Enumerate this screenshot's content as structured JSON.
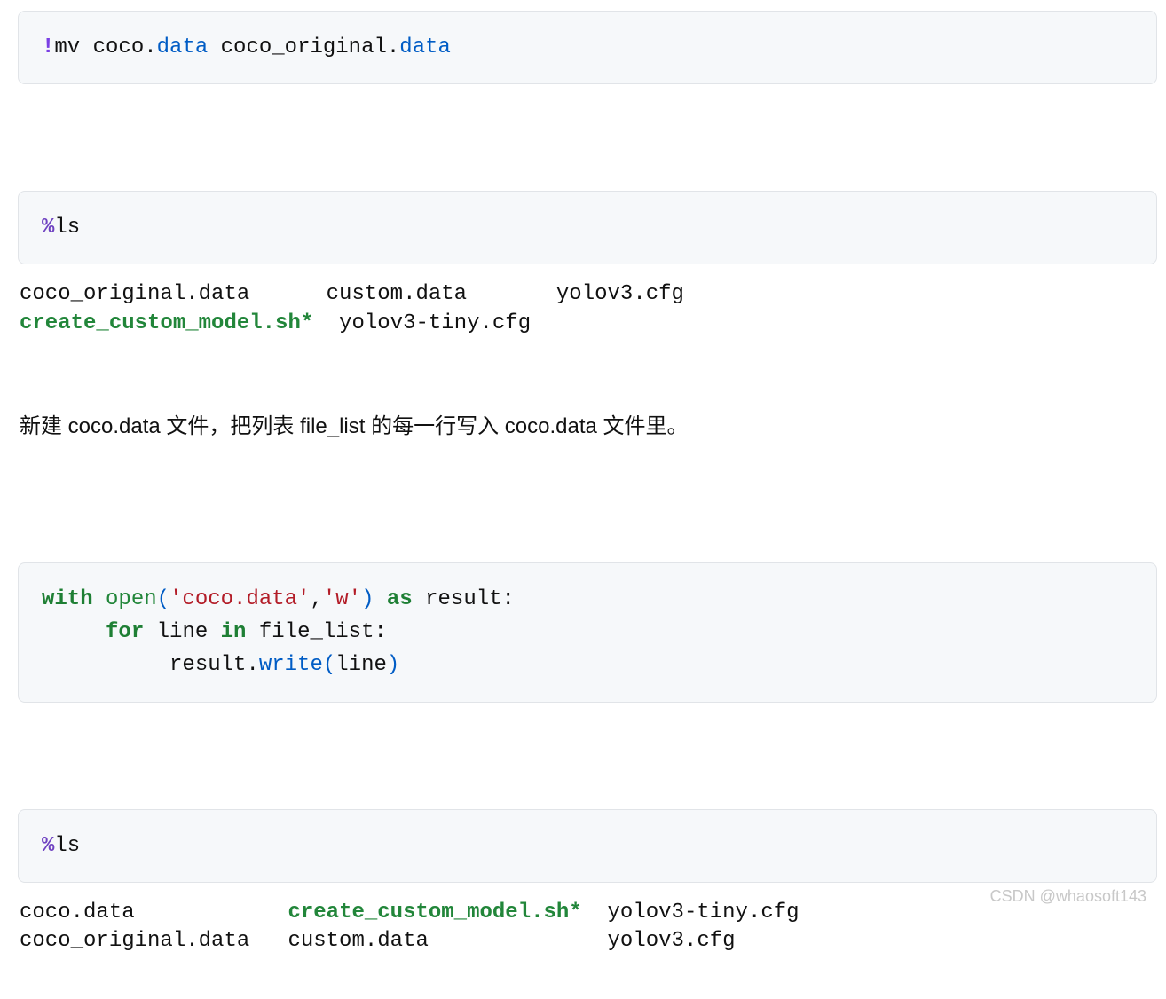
{
  "cells": {
    "c1": {
      "bang": "!",
      "cmd": "mv coco",
      "dot1": ".",
      "attr1": "data",
      "mid": " coco_original",
      "dot2": ".",
      "attr2": "data"
    },
    "c2": {
      "magic": "%",
      "cmd": "ls"
    },
    "out2": {
      "l1a": "coco_original.data      custom.data       yolov3.cfg",
      "l2a": "create_custom_model.sh",
      "l2star": "*",
      "l2b": "  yolov3-tiny.cfg"
    },
    "md1": "新建 coco.data 文件，把列表 file_list 的每一行写入 coco.data 文件里。",
    "c3": {
      "kw_with": "with",
      "sp1": " ",
      "open": "open",
      "lp": "(",
      "s1": "'coco.data'",
      "comma": ",",
      "s2": "'w'",
      "rp": ")",
      "sp2": " ",
      "kw_as": "as",
      "sp3": " result:",
      "indent2": "     ",
      "kw_for": "for",
      "for_mid": " line ",
      "kw_in": "in",
      "for_tail": " file_list:",
      "indent3": "          result",
      "dot": ".",
      "write": "write",
      "lp2": "(",
      "arg": "line",
      "rp2": ")"
    },
    "c4": {
      "magic": "%",
      "cmd": "ls"
    },
    "out4": {
      "l1a": "coco.data            ",
      "l1b": "create_custom_model.sh",
      "l1star": "*",
      "l1c": "  yolov3-tiny.cfg",
      "l2": "coco_original.data   custom.data              yolov3.cfg"
    }
  },
  "watermark": "CSDN @whaosoft143"
}
